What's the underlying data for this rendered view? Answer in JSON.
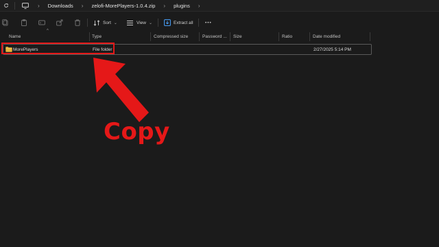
{
  "address_bar": {
    "breadcrumbs": [
      "Downloads",
      "zelofi-MorePlayers-1.0.4.zip",
      "plugins"
    ]
  },
  "toolbar": {
    "sort_label": "Sort",
    "view_label": "View",
    "extract_label": "Extract all",
    "more_label": "•••"
  },
  "columns": [
    "Name",
    "Type",
    "Compressed size",
    "Password ...",
    "Size",
    "Ratio",
    "Date modified"
  ],
  "rows": [
    {
      "name": "MorePlayers",
      "type": "File folder",
      "compressed_size": "",
      "password": "",
      "size": "",
      "ratio": "",
      "date_modified": "2/27/2025 5:14 PM"
    }
  ],
  "annotation": {
    "label": "Copy",
    "color": "#e51818"
  },
  "colors": {
    "background": "#1b1b1b",
    "folder_yellow": "#e8b53a",
    "accent_blue": "#4aa3ff"
  }
}
